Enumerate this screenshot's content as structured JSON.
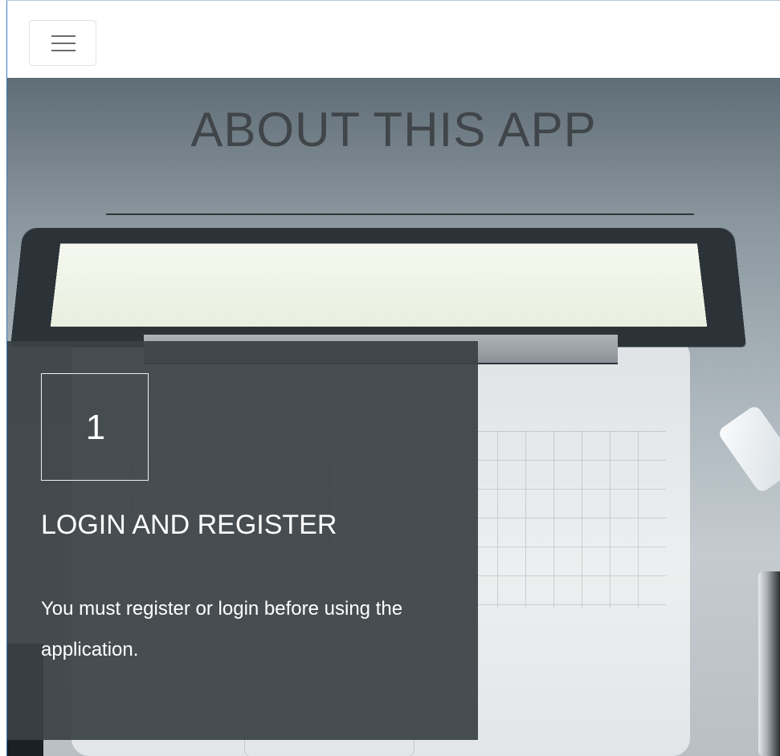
{
  "navbar": {
    "menu_toggle_icon": "hamburger-menu-icon"
  },
  "hero": {
    "title": "ABOUT THIS APP",
    "image": "laptop-keyboard-photo"
  },
  "step_card": {
    "number": "1",
    "title": "LOGIN AND REGISTER",
    "description": "You must register or login before using the application."
  },
  "colors": {
    "card_background": "#3a4144",
    "title_text": "#3f4549",
    "card_text": "#ffffff",
    "frame_accent": "#3b7bbf"
  }
}
